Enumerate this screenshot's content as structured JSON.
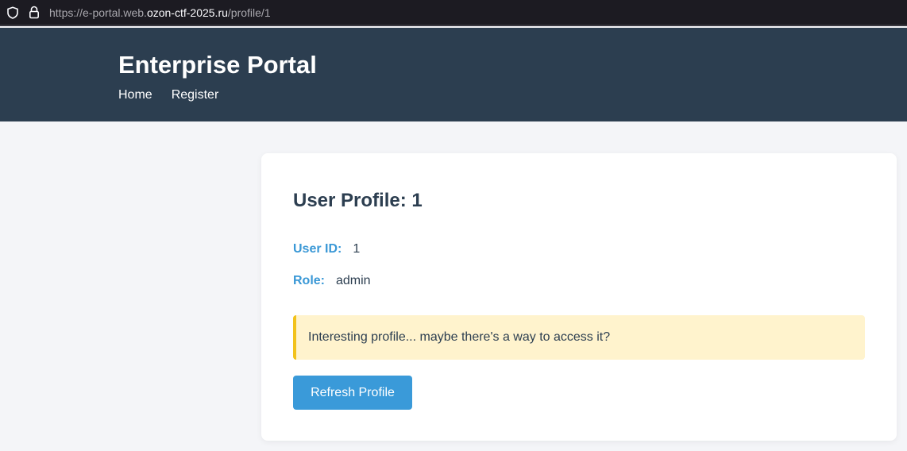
{
  "browser": {
    "url_prefix": "https://e-portal.web.",
    "url_host": "ozon-ctf-2025.ru",
    "url_path": "/profile/1",
    "icons": [
      "shield-icon",
      "lock-icon"
    ]
  },
  "header": {
    "title": "Enterprise Portal",
    "nav": [
      {
        "label": "Home"
      },
      {
        "label": "Register"
      }
    ],
    "background_color": "#2c3e50"
  },
  "profile": {
    "title": "User Profile: 1",
    "user_id_label": "User ID:",
    "user_id_value": "1",
    "role_label": "Role:",
    "role_value": "admin",
    "alert_text": "Interesting profile... maybe there's a way to access it?",
    "refresh_label": "Refresh Profile"
  },
  "colors": {
    "accent": "#3a9ad9",
    "label": "#3a98d6",
    "alert_background": "#fff3cd",
    "alert_border": "#f2c21b"
  }
}
